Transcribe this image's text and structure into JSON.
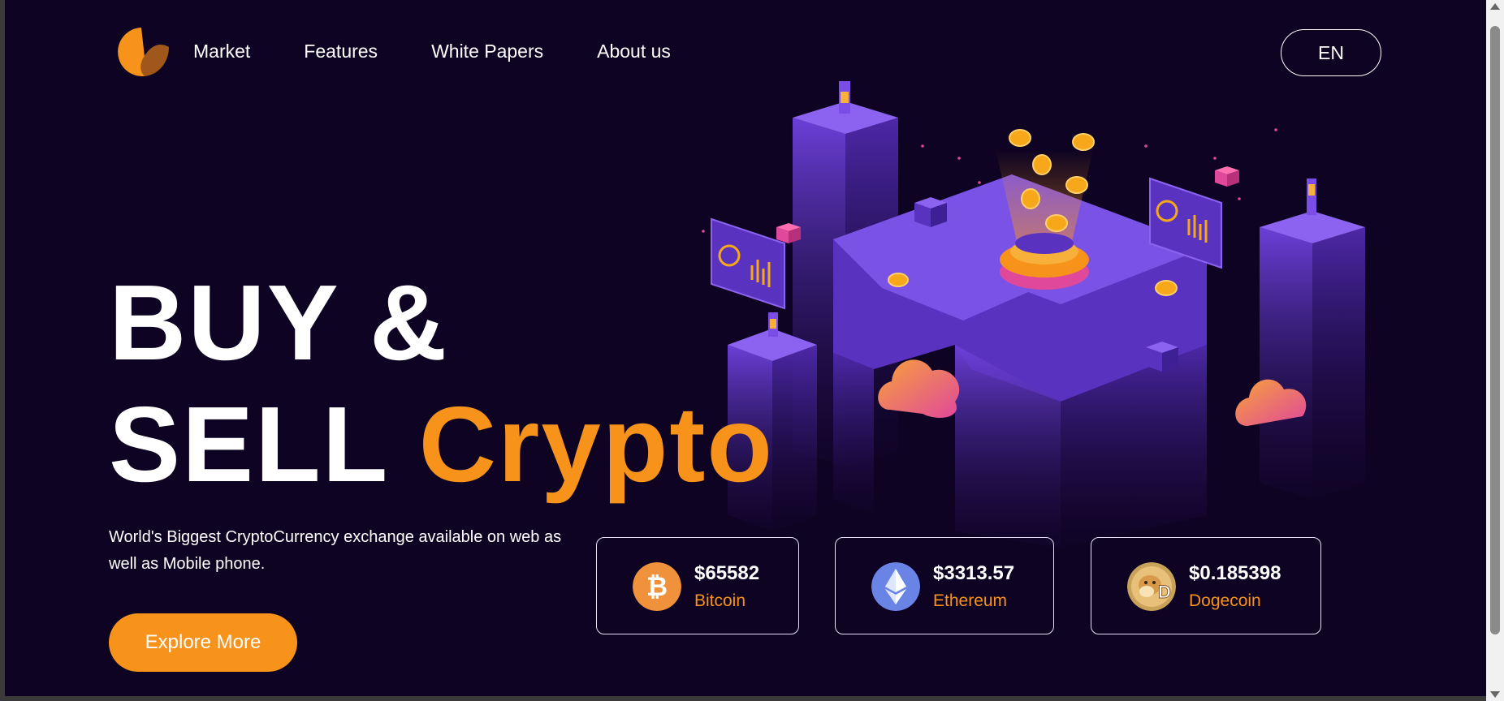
{
  "nav": {
    "items": [
      {
        "label": "Market"
      },
      {
        "label": "Features"
      },
      {
        "label": "White Papers"
      },
      {
        "label": "About us"
      }
    ],
    "language": "EN"
  },
  "hero": {
    "line1": "BUY &",
    "line2_prefix": "SELL",
    "line2_accent": "Crypto",
    "subtitle": "World's Biggest CryptoCurrency exchange available on web as well as Mobile phone.",
    "cta_label": "Explore More"
  },
  "coins": [
    {
      "price": "$65582",
      "name": "Bitcoin",
      "icon": "bitcoin-icon"
    },
    {
      "price": "$3313.57",
      "name": "Ethereum",
      "icon": "ethereum-icon"
    },
    {
      "price": "$0.185398",
      "name": "Dogecoin",
      "icon": "dogecoin-icon"
    }
  ],
  "colors": {
    "background": "#0e0322",
    "accent": "#f7931a",
    "text": "#ffffff",
    "illustration_purple": "#6a3fd6"
  }
}
